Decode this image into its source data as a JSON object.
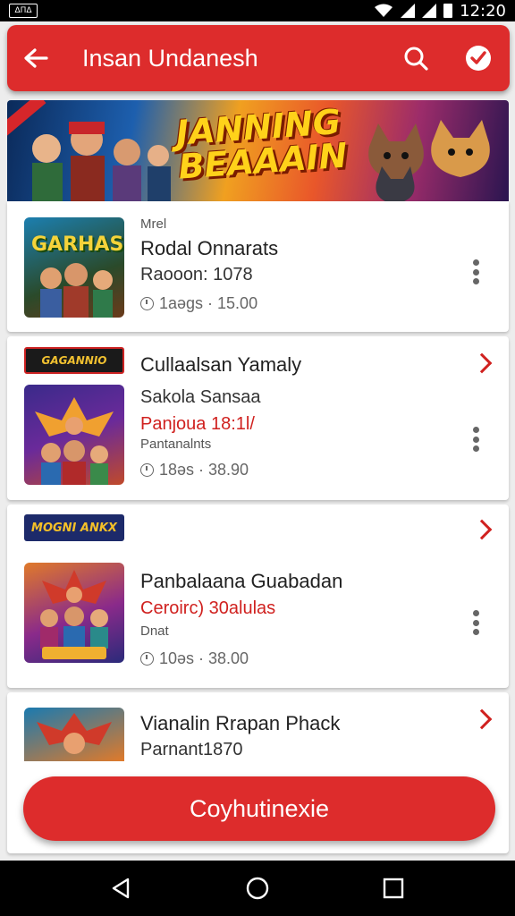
{
  "statusbar": {
    "time": "12:20",
    "left_icon": "ΔΠΔ"
  },
  "appbar": {
    "title": "Insan Undanesh",
    "color": "#dd2c2c"
  },
  "banner": {
    "headline_1": "JANNING",
    "headline_2": "BEAAAIN"
  },
  "cards": [
    {
      "label": "Mrel",
      "title": "Rodal Onnarats",
      "subtitle": "Raooon: 1078",
      "meta": "1aəgs · 15.00",
      "thumb_text": "GARHAS"
    },
    {
      "logo": "GAGANNIO",
      "title": "Cullaalsan Yamaly",
      "subtitle": "Sakola Sansaa",
      "price": "Panjoua 18:1l/",
      "small": "Pantanalnts",
      "meta": "18əs · 38.90"
    },
    {
      "logo": "MOGNI ANKX",
      "title": "Panbalaana Guabadan",
      "price": "Ceroirc) 30alulas",
      "small": "Dnat",
      "meta": "10əs · 38.00"
    },
    {
      "title": "Vianalin Rrapan Phack",
      "subtitle": "Parnant1870"
    }
  ],
  "cta": {
    "label": "Coyhutinexie"
  },
  "colors": {
    "accent": "#dd2c2c",
    "price": "#d0211f"
  }
}
